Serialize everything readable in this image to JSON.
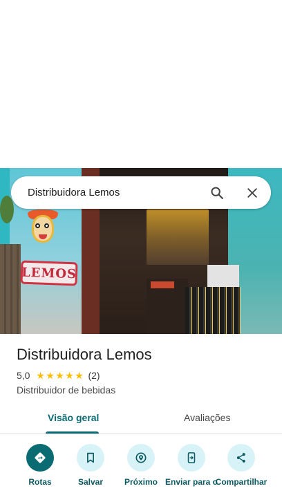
{
  "search": {
    "query": "Distribuidora Lemos"
  },
  "photo": {
    "sign_text": "LEMOS"
  },
  "place": {
    "name": "Distribuidora Lemos",
    "rating": "5,0",
    "stars": 5,
    "review_count": "(2)",
    "category": "Distribuidor de bebidas"
  },
  "tabs": [
    {
      "label": "Visão geral",
      "active": true
    },
    {
      "label": "Avaliações",
      "active": false
    }
  ],
  "actions": [
    {
      "label": "Rotas",
      "icon": "directions-icon"
    },
    {
      "label": "Salvar",
      "icon": "bookmark-icon"
    },
    {
      "label": "Próximo",
      "icon": "nearby-icon"
    },
    {
      "label": "Enviar para o",
      "icon": "send-to-phone-icon"
    },
    {
      "label": "Compartilhar",
      "icon": "share-icon"
    }
  ],
  "colors": {
    "accent": "#0b6b73",
    "action_bg": "#d7f3f8",
    "star": "#fbbc04"
  }
}
